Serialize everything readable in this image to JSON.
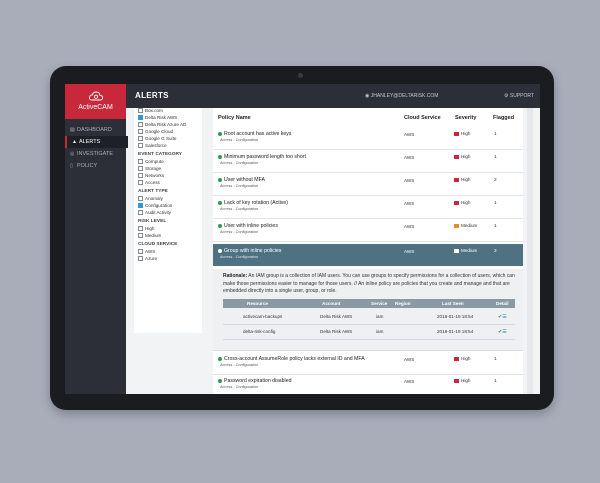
{
  "app": {
    "brand": "ActiveCAM",
    "title": "ALERTS"
  },
  "header": {
    "user": "JHANLEY@DELTARISK.COM",
    "support": "SUPPORT"
  },
  "nav": [
    {
      "label": "DASHBOARD",
      "icon": "dashboard-icon",
      "active": false
    },
    {
      "label": "ALERTS",
      "icon": "warning-icon",
      "active": true
    },
    {
      "label": "INVESTIGATE",
      "icon": "search-icon",
      "active": false
    },
    {
      "label": "POLICY",
      "icon": "document-icon",
      "active": false
    }
  ],
  "filters": {
    "accounts": [
      {
        "label": "Box.com",
        "checked": false
      },
      {
        "label": "Delta Risk AWS",
        "checked": true
      },
      {
        "label": "Delta Risk Azure AD",
        "checked": false
      },
      {
        "label": "Google Cloud",
        "checked": false
      },
      {
        "label": "Google G Suite",
        "checked": false
      },
      {
        "label": "Salesforce",
        "checked": false
      }
    ],
    "event_category": {
      "title": "EVENT CATEGORY",
      "items": [
        {
          "label": "Compute",
          "checked": false
        },
        {
          "label": "Storage",
          "checked": false
        },
        {
          "label": "Networks",
          "checked": false
        },
        {
          "label": "Access",
          "checked": false
        }
      ]
    },
    "alert_type": {
      "title": "ALERT TYPE",
      "items": [
        {
          "label": "Anomaly",
          "checked": false
        },
        {
          "label": "Configuration",
          "checked": true
        },
        {
          "label": "Audit Activity",
          "checked": false
        }
      ]
    },
    "risk_level": {
      "title": "RISK LEVEL",
      "items": [
        {
          "label": "High",
          "checked": false
        },
        {
          "label": "Medium",
          "checked": false
        }
      ]
    },
    "cloud_service": {
      "title": "CLOUD SERVICE",
      "items": [
        {
          "label": "AWS",
          "checked": false
        },
        {
          "label": "Azure",
          "checked": false
        }
      ]
    }
  },
  "table": {
    "headers": {
      "policy": "Policy Name",
      "cloud": "Cloud Service",
      "severity": "Severity",
      "flagged": "Flagged"
    },
    "rows": [
      {
        "name": "Root account has active keys",
        "sub": "Access - Configuration",
        "cloud": "AWS",
        "severity": "High",
        "flagged": "1"
      },
      {
        "name": "Minimum password length too short",
        "sub": "Access - Configuration",
        "cloud": "AWS",
        "severity": "High",
        "flagged": "1"
      },
      {
        "name": "User without MFA",
        "sub": "Access - Configuration",
        "cloud": "AWS",
        "severity": "High",
        "flagged": "2"
      },
      {
        "name": "Lack of key rotation (Active)",
        "sub": "Access - Configuration",
        "cloud": "AWS",
        "severity": "High",
        "flagged": "1"
      },
      {
        "name": "User with inline policies",
        "sub": "Access - Configuration",
        "cloud": "AWS",
        "severity": "Medium",
        "flagged": "1"
      },
      {
        "name": "Group with inline policies",
        "sub": "Access - Configuration",
        "cloud": "AWS",
        "severity": "Medium",
        "flagged": "2",
        "selected": true
      }
    ],
    "rows_after": [
      {
        "name": "Cross-account AssumeRole policy lacks external ID and MFA",
        "sub": "Access - Configuration",
        "cloud": "AWS",
        "severity": "High",
        "flagged": "1"
      },
      {
        "name": "Password expiration disabled",
        "sub": "Access - Configuration",
        "cloud": "AWS",
        "severity": "High",
        "flagged": "1"
      }
    ]
  },
  "detail": {
    "rationale_label": "Rationale:",
    "rationale_text": "An IAM group is a collection of IAM users. You can use groups to specify permissions for a collection of users, which can make those permissions easier to manage for those users. // An inline policy are policies that you create and manage and that are embedded directly into a single user, group, or role.",
    "headers": {
      "resource": "Resource",
      "account": "Account",
      "service": "Service",
      "region": "Region",
      "last_seen": "Last Seen",
      "detail": "Detail"
    },
    "rows": [
      {
        "resource": "activecam-backups",
        "account": "Delta Risk AWS",
        "service": "iam",
        "region": "",
        "last_seen": "2018-01-19 18:54"
      },
      {
        "resource": "delta-risk-config",
        "account": "Delta Risk AWS",
        "service": "iam",
        "region": "",
        "last_seen": "2018-01-19 18:54"
      }
    ]
  },
  "colors": {
    "brand": "#c8283a",
    "nav_bg": "#2c2f37",
    "selected_row": "#4f7282",
    "high": "#c8283a",
    "medium": "#e58b2a",
    "ok": "#2f9a55"
  }
}
